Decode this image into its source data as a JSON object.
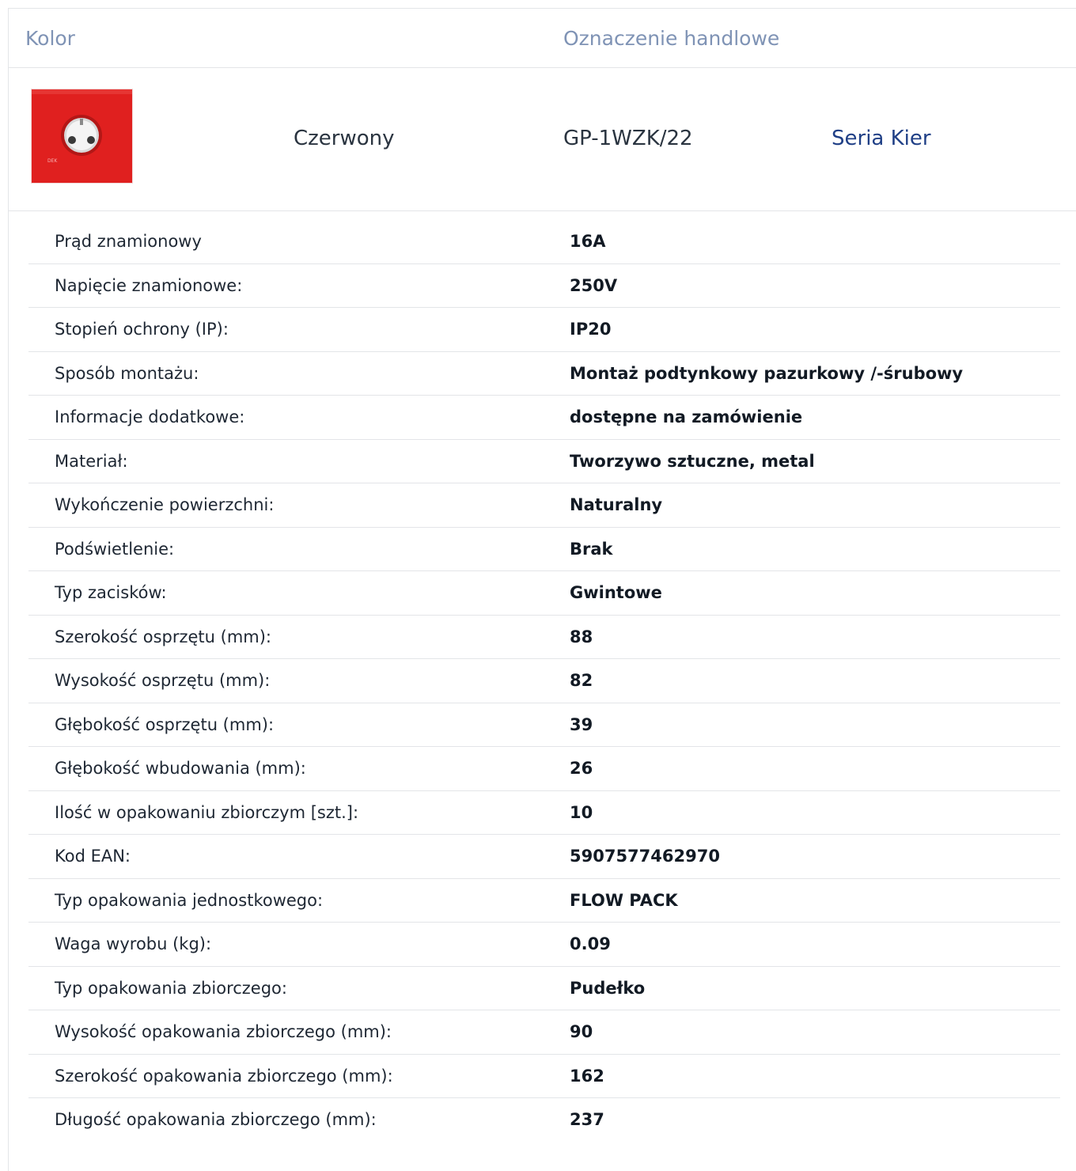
{
  "header": {
    "color_label": "Kolor",
    "trade_label": "Oznaczenie handlowe"
  },
  "product": {
    "image": "red-socket-image",
    "color_value": "Czerwony",
    "code": "GP-1WZK/22",
    "series_link": "Seria Kier",
    "accent_color": "#e0201f"
  },
  "specs": [
    {
      "label": "Prąd znamionowy",
      "value": "16A"
    },
    {
      "label": "Napięcie znamionowe:",
      "value": "250V"
    },
    {
      "label": "Stopień ochrony (IP):",
      "value": "IP20"
    },
    {
      "label": "Sposób montażu:",
      "value": "Montaż podtynkowy pazurkowy /-śrubowy"
    },
    {
      "label": "Informacje dodatkowe:",
      "value": "dostępne na zamówienie"
    },
    {
      "label": "Materiał:",
      "value": "Tworzywo sztuczne, metal"
    },
    {
      "label": "Wykończenie powierzchni:",
      "value": "Naturalny"
    },
    {
      "label": "Podświetlenie:",
      "value": "Brak"
    },
    {
      "label": "Typ zacisków:",
      "value": "Gwintowe"
    },
    {
      "label": "Szerokość osprzętu (mm):",
      "value": "88"
    },
    {
      "label": "Wysokość osprzętu (mm):",
      "value": "82"
    },
    {
      "label": "Głębokość osprzętu (mm):",
      "value": "39"
    },
    {
      "label": "Głębokość wbudowania (mm):",
      "value": "26"
    },
    {
      "label": "Ilość w opakowaniu zbiorczym [szt.]:",
      "value": "10"
    },
    {
      "label": "Kod EAN:",
      "value": "5907577462970"
    },
    {
      "label": "Typ opakowania jednostkowego:",
      "value": "FLOW PACK"
    },
    {
      "label": "Waga wyrobu (kg):",
      "value": "0.09"
    },
    {
      "label": "Typ opakowania zbiorczego:",
      "value": "Pudełko"
    },
    {
      "label": "Wysokość opakowania zbiorczego (mm):",
      "value": "90"
    },
    {
      "label": "Szerokość opakowania zbiorczego (mm):",
      "value": "162"
    },
    {
      "label": "Długość opakowania zbiorczego (mm):",
      "value": "237"
    }
  ]
}
